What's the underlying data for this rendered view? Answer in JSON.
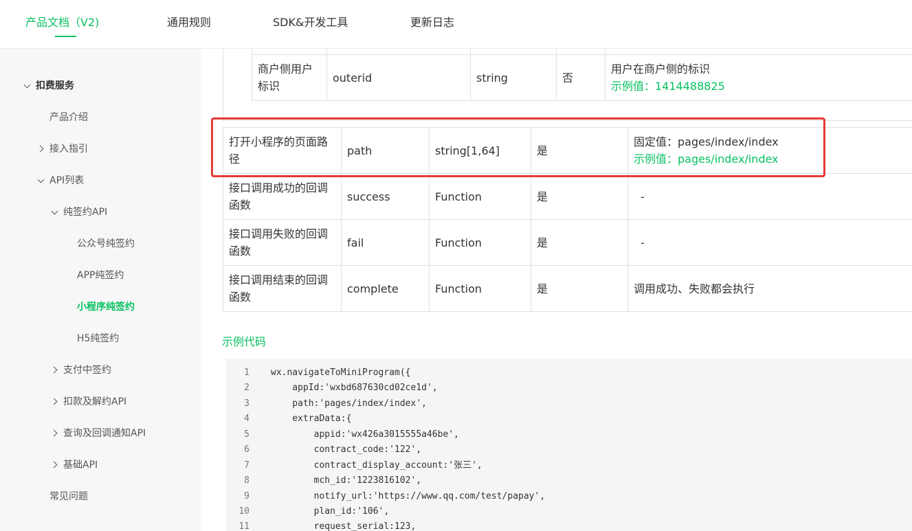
{
  "topnav": {
    "tabs": [
      {
        "label": "产品文档（V2)"
      },
      {
        "label": "通用规则"
      },
      {
        "label": "SDK&开发工具"
      },
      {
        "label": "更新日志"
      }
    ]
  },
  "sidebar": {
    "section": "扣费服务",
    "items": [
      {
        "label": "产品介绍"
      },
      {
        "label": "接入指引"
      },
      {
        "label": "API列表"
      },
      {
        "label": "纯签约API"
      },
      {
        "label": "公众号纯签约"
      },
      {
        "label": "APP纯签约"
      },
      {
        "label": "小程序纯签约"
      },
      {
        "label": "H5纯签约"
      },
      {
        "label": "支付中签约"
      },
      {
        "label": "扣款及解约API"
      },
      {
        "label": "查询及回调通知API"
      },
      {
        "label": "基础API"
      },
      {
        "label": "常见问题"
      }
    ]
  },
  "nested_table": {
    "row": {
      "name": "商户侧用户标识",
      "field": "outerid",
      "type": "string",
      "required": "否",
      "desc": "用户在商户侧的标识",
      "example": "示例值：1414488825"
    }
  },
  "params_table": {
    "rows": [
      {
        "name": "打开小程序的页面路径",
        "field": "path",
        "type": "string[1,64]",
        "required": "是",
        "desc": "固定值：pages/index/index",
        "example": "示例值：pages/index/index"
      },
      {
        "name": "接口调用成功的回调函数",
        "field": "success",
        "type": "Function",
        "required": "是",
        "desc": "-"
      },
      {
        "name": "接口调用失败的回调函数",
        "field": "fail",
        "type": "Function",
        "required": "是",
        "desc": "-"
      },
      {
        "name": "接口调用结束的回调函数",
        "field": "complete",
        "type": "Function",
        "required": "是",
        "desc": "调用成功、失败都会执行"
      }
    ]
  },
  "example_title": "示例代码",
  "code": {
    "lines": [
      {
        "n": "1",
        "text": "wx.navigateToMiniProgram({"
      },
      {
        "n": "2",
        "text": "    appId:'wxbd687630cd02ce1d',"
      },
      {
        "n": "3",
        "text": "    path:'pages/index/index',"
      },
      {
        "n": "4",
        "text": "    extraData:{"
      },
      {
        "n": "5",
        "text": "        appid:'wx426a3015555a46be',"
      },
      {
        "n": "6",
        "text": "        contract_code:'122',"
      },
      {
        "n": "7",
        "text": "        contract_display_account:'张三',"
      },
      {
        "n": "8",
        "text": "        mch_id:'1223816102',"
      },
      {
        "n": "9",
        "text": "        notify_url:'https://www.qq.com/test/papay',"
      },
      {
        "n": "10",
        "text": "        plan_id:'106',"
      },
      {
        "n": "11",
        "text": "        request_serial:123,"
      }
    ]
  },
  "colors": {
    "accent": "#07c160",
    "highlight": "#e53935"
  }
}
